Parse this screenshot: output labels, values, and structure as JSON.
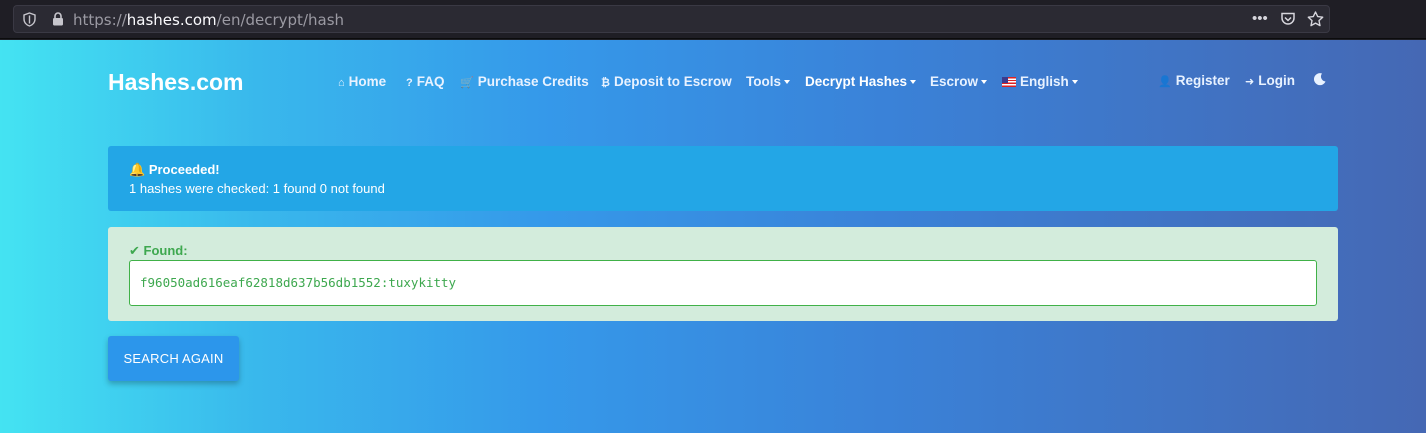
{
  "browser": {
    "url_prefix": "https://",
    "url_host": "hashes.com",
    "url_path": "/en/decrypt/hash",
    "icons": [
      "shield-icon",
      "lock-icon",
      "more-icon",
      "pocket-icon",
      "star-icon"
    ]
  },
  "header": {
    "brand": "Hashes.com",
    "nav": {
      "home": "Home",
      "faq": "FAQ",
      "purchase": "Purchase Credits",
      "deposit": "Deposit to Escrow",
      "tools": "Tools",
      "decrypt": "Decrypt Hashes",
      "escrow": "Escrow",
      "language": "English",
      "register": "Register",
      "login": "Login"
    }
  },
  "alert": {
    "title": "Proceeded!",
    "message": "1 hashes were checked: 1 found 0 not found"
  },
  "found": {
    "label": "Found:",
    "result": "f96050ad616eaf62818d637b56db1552:tuxykitty"
  },
  "actions": {
    "search_again": "SEARCH AGAIN"
  },
  "colors": {
    "alert_bg": "#23a6e6",
    "found_bg": "#d3ecdc",
    "found_text": "#3ea84f",
    "button_bg": "#2c96eb"
  }
}
